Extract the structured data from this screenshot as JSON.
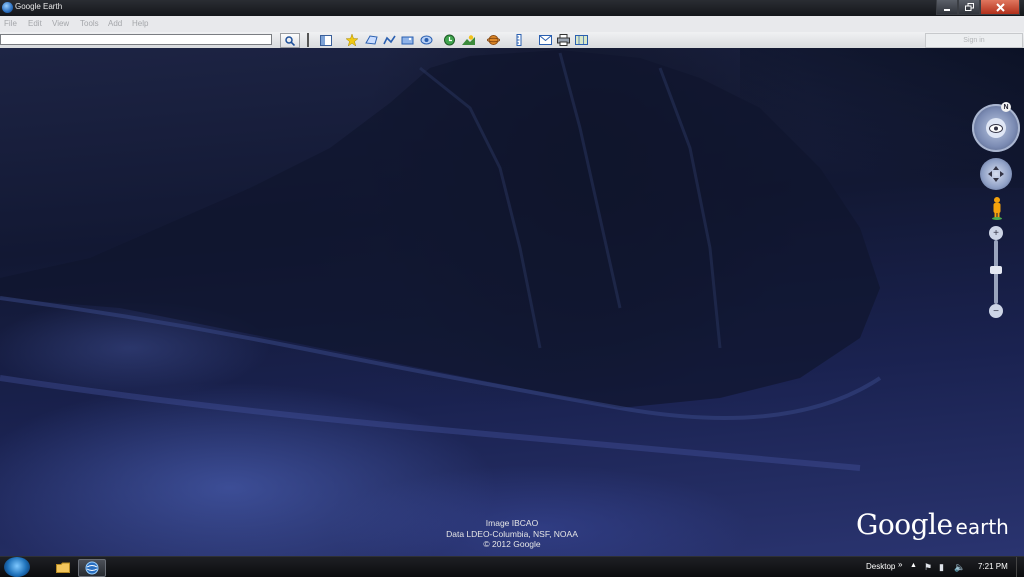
{
  "window": {
    "title": "Google Earth"
  },
  "menu": {
    "items": [
      "File",
      "Edit",
      "View",
      "Tools",
      "Add",
      "Help"
    ]
  },
  "toolbar": {
    "search_value": "",
    "sign_in_label": "Sign in"
  },
  "map": {
    "attribution": [
      "Image IBCAO",
      "Data LDEO-Columbia, NSF, NOAA",
      "© 2012 Google"
    ],
    "logo_google": "Google",
    "logo_earth": "earth",
    "compass_north": "N"
  },
  "taskbar": {
    "desktop_label": "Desktop",
    "chevron": "»",
    "clock": "7:21 PM"
  },
  "colors": {
    "ocean": "#1a2250",
    "accent": "#2a6fc0",
    "close": "#c8442a"
  }
}
